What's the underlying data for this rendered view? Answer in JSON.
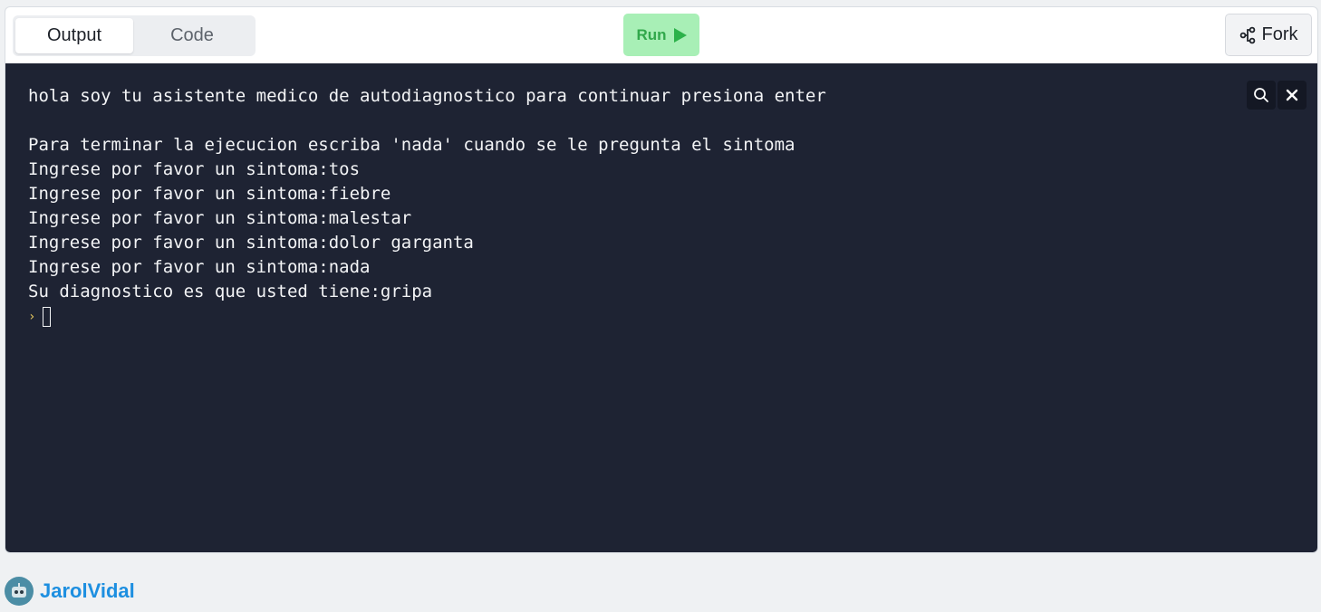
{
  "tabs": [
    {
      "label": "Output",
      "active": true
    },
    {
      "label": "Code",
      "active": false
    }
  ],
  "run_button": {
    "label": "Run",
    "icon": "play-icon",
    "color": "#31a84b"
  },
  "fork_button": {
    "label": "Fork",
    "icon": "fork-icon"
  },
  "console": {
    "lines": [
      "hola soy tu asistente medico de autodiagnostico para continuar presiona enter",
      "",
      "Para terminar la ejecucion escriba 'nada' cuando se le pregunta el sintoma",
      "Ingrese por favor un sintoma:tos",
      "Ingrese por favor un sintoma:fiebre",
      "Ingrese por favor un sintoma:malestar",
      "Ingrese por favor un sintoma:dolor garganta",
      "Ingrese por favor un sintoma:nada",
      "Su diagnostico es que usted tiene:gripa"
    ],
    "prompt_symbol": "›",
    "background": "#1e2333",
    "tools": [
      "search-icon",
      "close-icon"
    ]
  },
  "footer": {
    "username": "JarolVidal",
    "avatar_icon": "robot-avatar-icon",
    "username_color": "#1d8fe0"
  }
}
